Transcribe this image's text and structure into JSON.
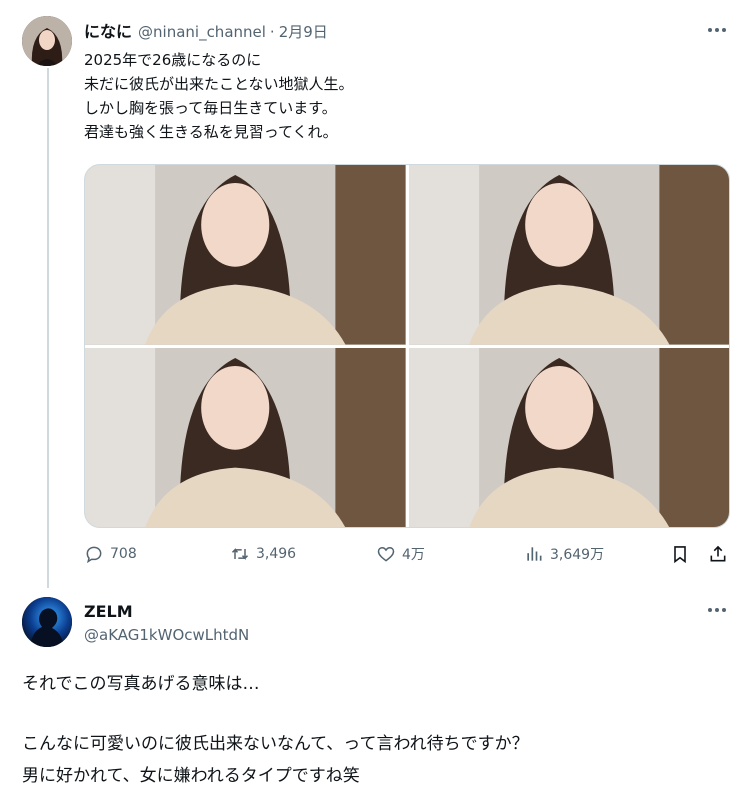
{
  "tweet": {
    "author_name": "になに",
    "author_handle": "@ninani_channel",
    "separator": "·",
    "date": "2月9日",
    "lines": [
      "2025年で26歳になるのに",
      "未だに彼氏が出来たことない地獄人生。",
      "しかし胸を張って毎日生きています。",
      "君達も強く生きる私を見習ってくれ。"
    ],
    "photos_count": 4,
    "stats": {
      "replies": "708",
      "retweets": "3,496",
      "likes": "4万",
      "views": "3,649万"
    }
  },
  "reply": {
    "author_name": "ZELM",
    "author_handle": "@aKAG1kWOcwLhtdN",
    "lines": [
      "それでこの写真あげる意味は…",
      "こんなに可愛いのに彼氏出来ないなんて、って言われ待ちですか？",
      "男に好かれて、女に嫌われるタイプですね笑"
    ]
  },
  "icons": {
    "reply": "speech-bubble-icon",
    "retweet": "retweet-icon",
    "like": "heart-icon",
    "views": "bar-chart-icon",
    "bookmark": "bookmark-icon",
    "share": "share-icon",
    "more": "ellipsis-icon"
  },
  "colors": {
    "text": "#0f1419",
    "secondary_text": "#536471",
    "thread_line": "#cfd9de",
    "background": "#ffffff"
  }
}
